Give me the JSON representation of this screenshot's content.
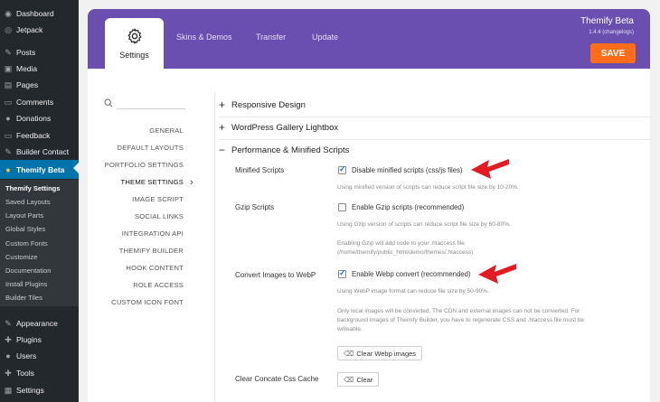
{
  "wp_menu": [
    {
      "label": "Dashboard",
      "icon": "dashboard-icon",
      "glyph": "◉"
    },
    {
      "label": "Jetpack",
      "icon": "jetpack-icon",
      "glyph": "◎"
    },
    {
      "label": "Posts",
      "icon": "pin-icon",
      "glyph": "✎"
    },
    {
      "label": "Media",
      "icon": "media-icon",
      "glyph": "▣"
    },
    {
      "label": "Pages",
      "icon": "pages-icon",
      "glyph": "▤"
    },
    {
      "label": "Comments",
      "icon": "comments-icon",
      "glyph": "▭"
    },
    {
      "label": "Donations",
      "icon": "donations-icon",
      "glyph": "●"
    },
    {
      "label": "Feedback",
      "icon": "feedback-icon",
      "glyph": "▭"
    },
    {
      "label": "Builder Contact",
      "icon": "contact-icon",
      "glyph": "✎"
    },
    {
      "label": "Themify Beta",
      "icon": "themify-icon",
      "glyph": "●"
    },
    {
      "label": "Appearance",
      "icon": "appearance-icon",
      "glyph": "✎"
    },
    {
      "label": "Plugins",
      "icon": "plugins-icon",
      "glyph": "✚"
    },
    {
      "label": "Users",
      "icon": "users-icon",
      "glyph": "●"
    },
    {
      "label": "Tools",
      "icon": "tools-icon",
      "glyph": "✚"
    },
    {
      "label": "Settings",
      "icon": "settings-icon",
      "glyph": "▦"
    }
  ],
  "wp_submenu": [
    "Themify Settings",
    "Saved Layouts",
    "Layout Parts",
    "Global Styles",
    "Custom Fonts",
    "Customize",
    "Documentation",
    "Install Plugins",
    "Builder Tiles"
  ],
  "header": {
    "tabs": {
      "settings": "Settings",
      "skins": "Skins & Demos",
      "transfer": "Transfer",
      "update": "Update"
    },
    "brand": "Themify Beta",
    "version": "1.4.4 (changelogs)",
    "save": "SAVE"
  },
  "settings_nav": [
    "GENERAL",
    "DEFAULT LAYOUTS",
    "PORTFOLIO SETTINGS",
    "THEME SETTINGS",
    "IMAGE SCRIPT",
    "SOCIAL LINKS",
    "INTEGRATION API",
    "THEMIFY BUILDER",
    "HOOK CONTENT",
    "ROLE ACCESS",
    "CUSTOM ICON FONT"
  ],
  "sections": {
    "responsive": "Responsive Design",
    "gallery": "WordPress Gallery Lightbox",
    "performance": "Performance & Minified Scripts"
  },
  "rows": {
    "minified_label": "Minified Scripts",
    "minified_checkbox": "Disable minified scripts (css/js files)",
    "minified_desc": "Using minified version of scripts can reduce script file size by 10-20%.",
    "gzip_label": "Gzip Scripts",
    "gzip_checkbox": "Enable Gzip scripts (recommended)",
    "gzip_desc": "Using Gzip version of scripts can reduce script file size by 60-80%.",
    "gzip_note": "Enabling Gzip will add code to your .htaccess file (/home/themify/public_html/demo/themes/.htaccess)",
    "webp_label": "Convert Images to WebP",
    "webp_checkbox": "Enable Webp convert (recommended)",
    "webp_desc": "Using WebP image format can reduce file size by 50-90%.",
    "webp_note": "Only local images will be converted. The CDN and external images can not be converted. For background images of Themify Builder, you have to regenerate CSS and .htaccess file must be writeable.",
    "webp_button": "Clear Webp images",
    "concat_label": "Clear Concate Css Cache",
    "concat_button": "Clear"
  },
  "colors": {
    "header": "#6a4fb0",
    "save": "#ff6d1a",
    "wp_active": "#0073aa",
    "arrow": "#e31b23"
  }
}
